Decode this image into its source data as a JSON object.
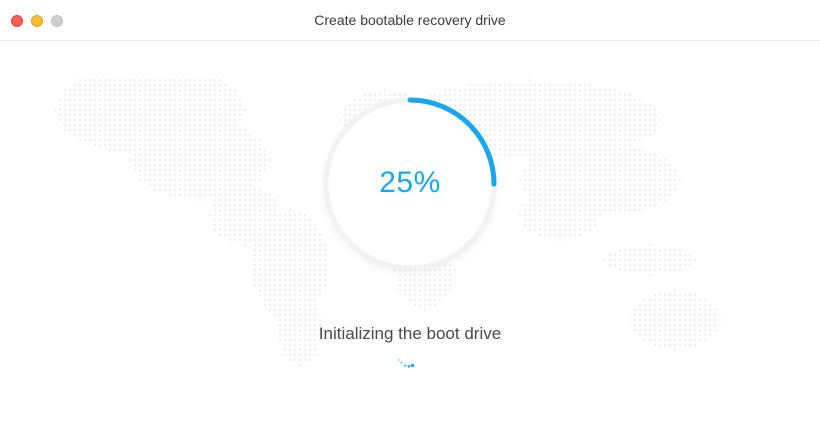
{
  "window": {
    "title": "Create bootable recovery drive"
  },
  "progress": {
    "value": 25,
    "label": "25%",
    "color": "#1aa6ec"
  },
  "status": {
    "text": "Initializing the boot drive"
  },
  "icons": {
    "close": "close-traffic-light",
    "minimize": "minimize-traffic-light",
    "zoom": "zoom-traffic-light",
    "spinner": "loading-spinner-icon"
  }
}
